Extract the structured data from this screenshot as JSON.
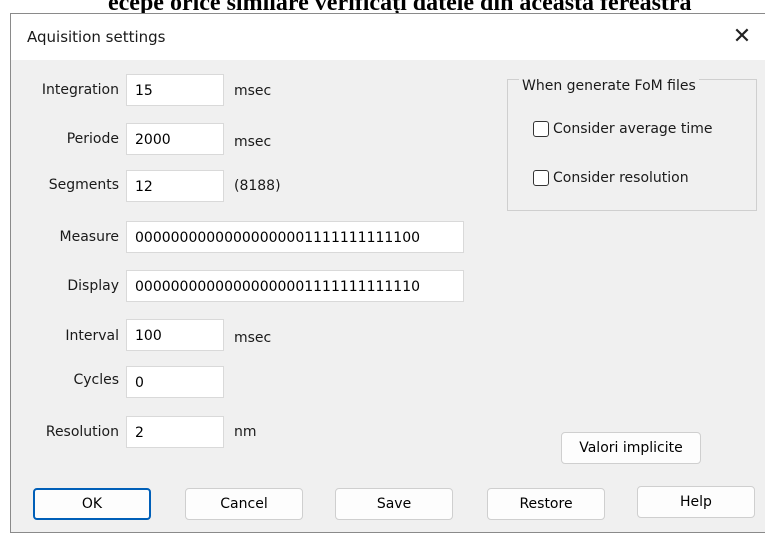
{
  "background_text": "ecepe orice similare verificați datele din această fereastră",
  "dialog": {
    "title": "Aquisition settings",
    "close_glyph": "✕"
  },
  "fields": [
    {
      "label": "Integration",
      "value": "15",
      "unit": "msec"
    },
    {
      "label": "Periode",
      "value": "2000",
      "unit": "msec"
    },
    {
      "label": "Segments",
      "value": "12",
      "unit": "(8188)"
    },
    {
      "label": "Measure",
      "value": "00000000000000000001111111111100",
      "unit": ""
    },
    {
      "label": "Display",
      "value": "00000000000000000001111111111110",
      "unit": ""
    },
    {
      "label": "Interval",
      "value": "100",
      "unit": "msec"
    },
    {
      "label": "Cycles",
      "value": "0",
      "unit": ""
    },
    {
      "label": "Resolution",
      "value": "2",
      "unit": "nm"
    }
  ],
  "fom_group": {
    "title": "When generate FoM files",
    "options": [
      {
        "label": "Consider average time",
        "checked": false
      },
      {
        "label": "Consider resolution",
        "checked": false
      }
    ]
  },
  "buttons": {
    "defaults": "Valori implicite",
    "ok": "OK",
    "cancel": "Cancel",
    "save": "Save",
    "restore": "Restore",
    "help": "Help"
  },
  "colors": {
    "dialog_bg": "#f0f0f0",
    "titlebar_bg": "#ffffff",
    "default_button_border": "#005fb8"
  }
}
